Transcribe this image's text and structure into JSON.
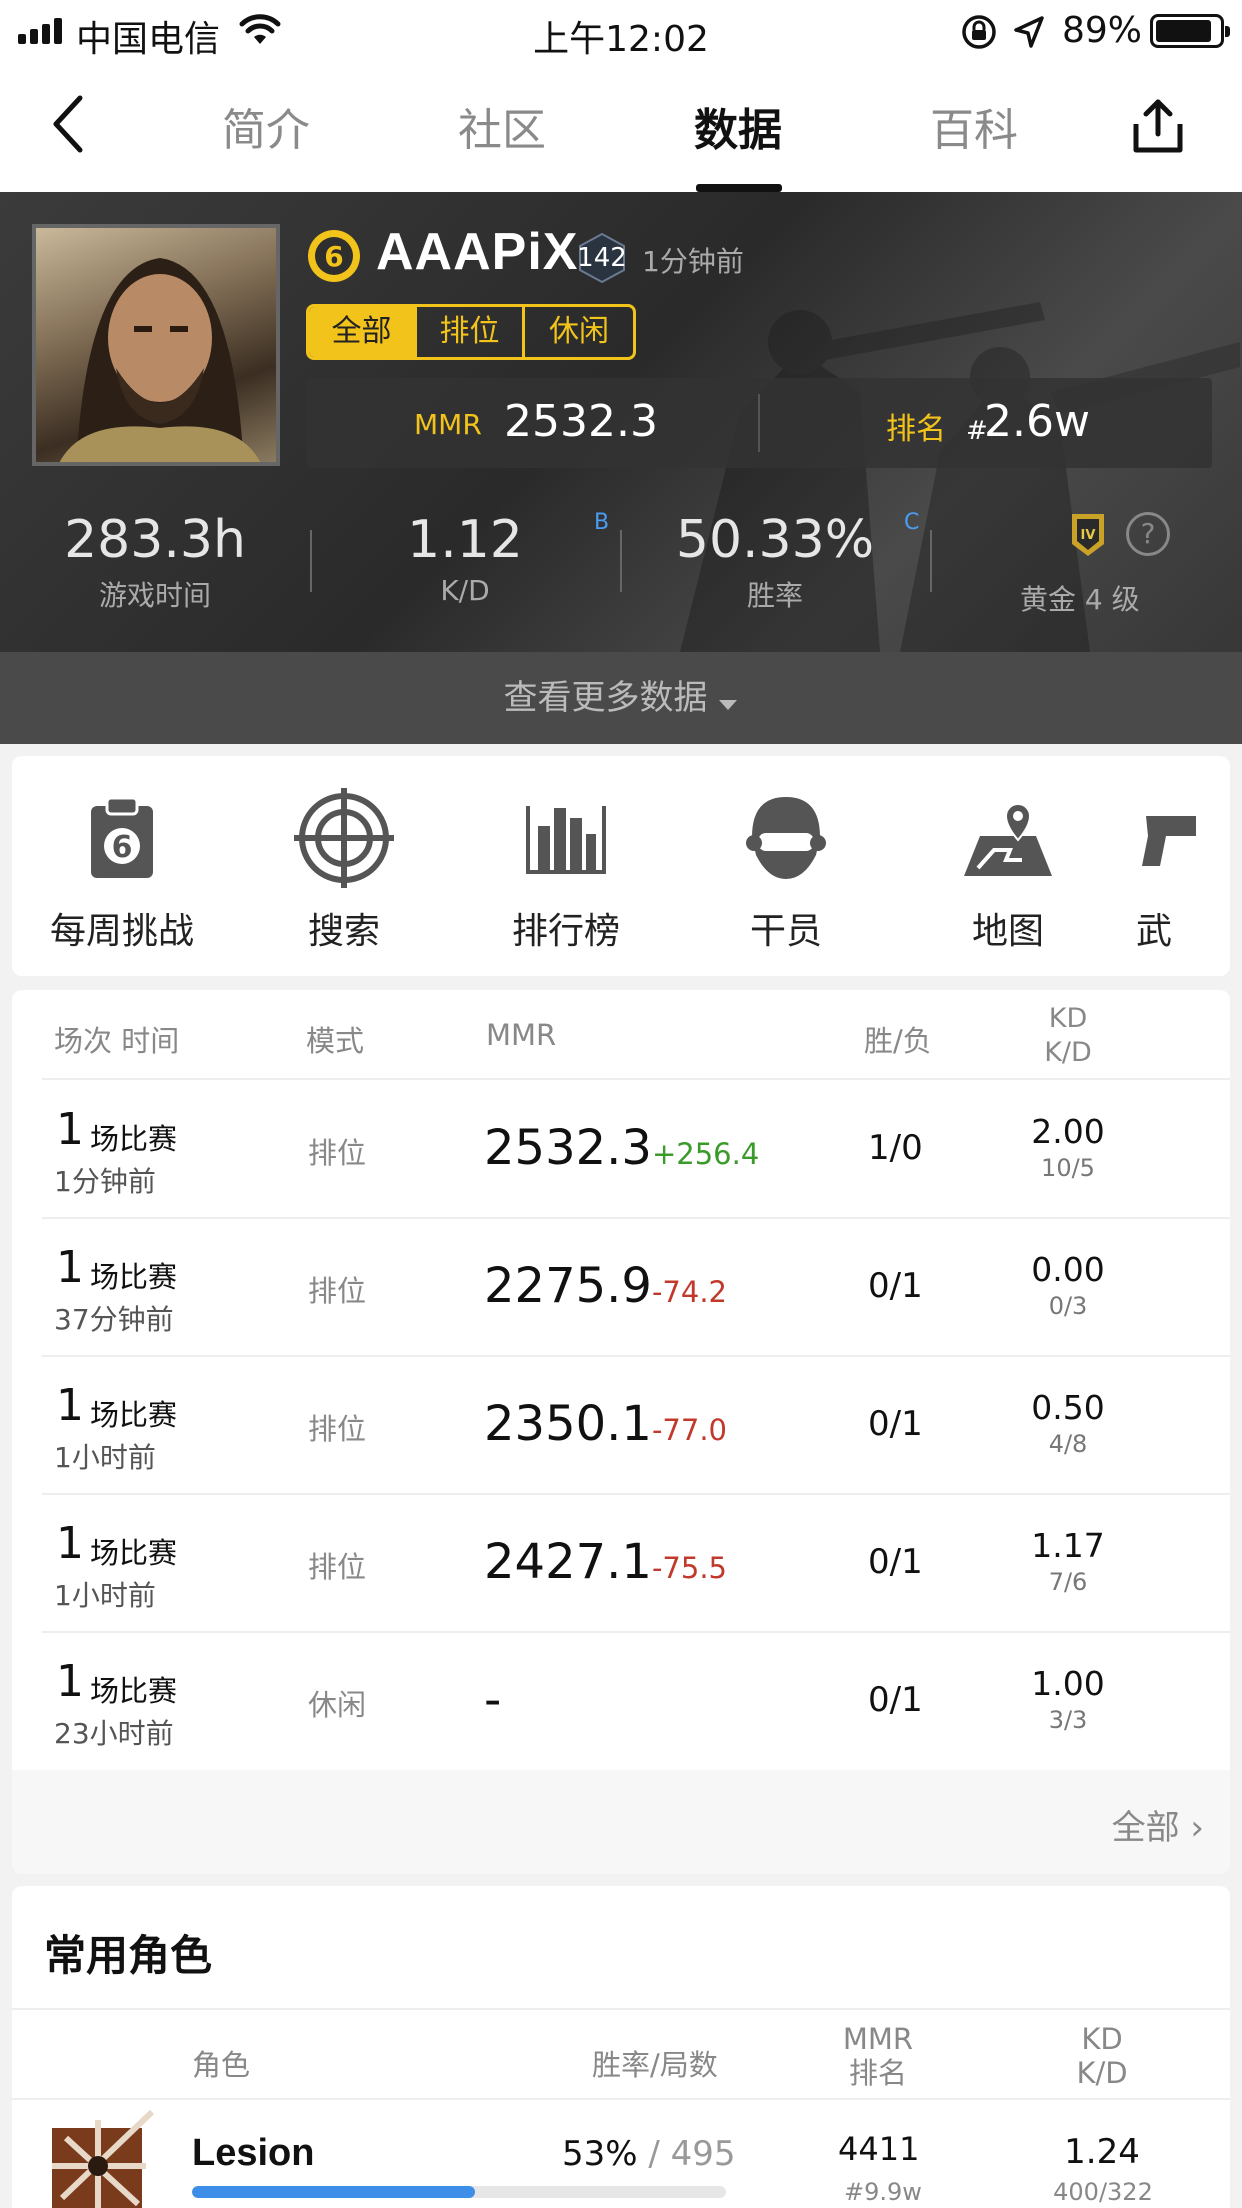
{
  "status_bar": {
    "carrier": "中国电信",
    "time": "上午12:02",
    "battery": "89%",
    "battery_level": 0.89
  },
  "nav": {
    "tabs": [
      {
        "label": "简介"
      },
      {
        "label": "社区"
      },
      {
        "label": "数据"
      },
      {
        "label": "百科"
      }
    ],
    "active_tab": "数据"
  },
  "profile": {
    "name": "AAAPiX",
    "level": "142",
    "last_seen": "1分钟前",
    "filters": [
      "全部",
      "排位",
      "休闲"
    ],
    "active_filter": "全部",
    "mmr_label": "MMR",
    "mmr_value": "2532.3",
    "rank_label": "排名",
    "rank_hash": "#",
    "rank_value": "2.6w",
    "stats": [
      {
        "value": "283.3h",
        "label": "游戏时间",
        "grade": ""
      },
      {
        "value": "1.12",
        "label": "K/D",
        "grade": "B"
      },
      {
        "value": "50.33%",
        "label": "胜率",
        "grade": "C"
      }
    ],
    "rank_name": "黄金 4 级",
    "rank_badge": "IV",
    "help": "?",
    "more_label": "查看更多数据"
  },
  "quick_menu": [
    {
      "label": "每周挑战",
      "icon": "clipboard-six-icon"
    },
    {
      "label": "搜索",
      "icon": "crosshair-icon"
    },
    {
      "label": "排行榜",
      "icon": "bar-chart-icon"
    },
    {
      "label": "干员",
      "icon": "operator-helmet-icon"
    },
    {
      "label": "地图",
      "icon": "map-pin-icon"
    },
    {
      "label": "武",
      "icon": "gun-icon"
    }
  ],
  "matches": {
    "headers": {
      "session": "场次 时间",
      "mode": "模式",
      "mmr": "MMR",
      "wl": "胜/负",
      "kd1": "KD",
      "kd2": "K/D"
    },
    "rows": [
      {
        "count": "1",
        "count_label": "场比赛",
        "ago": "1分钟前",
        "mode": "排位",
        "mmr": "2532.3",
        "delta": "+256.4",
        "dir": "up",
        "wl": "1/0",
        "kd": "2.00",
        "kd_raw": "10/5"
      },
      {
        "count": "1",
        "count_label": "场比赛",
        "ago": "37分钟前",
        "mode": "排位",
        "mmr": "2275.9",
        "delta": "-74.2",
        "dir": "down",
        "wl": "0/1",
        "kd": "0.00",
        "kd_raw": "0/3"
      },
      {
        "count": "1",
        "count_label": "场比赛",
        "ago": "1小时前",
        "mode": "排位",
        "mmr": "2350.1",
        "delta": "-77.0",
        "dir": "down",
        "wl": "0/1",
        "kd": "0.50",
        "kd_raw": "4/8"
      },
      {
        "count": "1",
        "count_label": "场比赛",
        "ago": "1小时前",
        "mode": "排位",
        "mmr": "2427.1",
        "delta": "-75.5",
        "dir": "down",
        "wl": "0/1",
        "kd": "1.17",
        "kd_raw": "7/6"
      },
      {
        "count": "1",
        "count_label": "场比赛",
        "ago": "23小时前",
        "mode": "休闲",
        "mmr": "-",
        "delta": "",
        "dir": "none",
        "wl": "0/1",
        "kd": "1.00",
        "kd_raw": "3/3"
      }
    ],
    "all_label": "全部 ›"
  },
  "characters": {
    "title": "常用角色",
    "headers": {
      "role": "角色",
      "rate": "胜率/局数",
      "mmr1": "MMR",
      "mmr2": "排名",
      "kd1": "KD",
      "kd2": "K/D"
    },
    "items": [
      {
        "name": "Lesion",
        "win_rate": "53%",
        "sep": " / ",
        "games": "495",
        "mmr": "4411",
        "rank": "#9.9w",
        "kd": "1.24",
        "kd_raw": "400/322",
        "bar_fraction": 0.53
      }
    ]
  },
  "colors": {
    "accent_yellow": "#f2c31a",
    "win_green": "#3a9a2a",
    "loss_red": "#c0392b",
    "bar_blue": "#3d8ee8",
    "grade_blue": "#4a9df0"
  }
}
